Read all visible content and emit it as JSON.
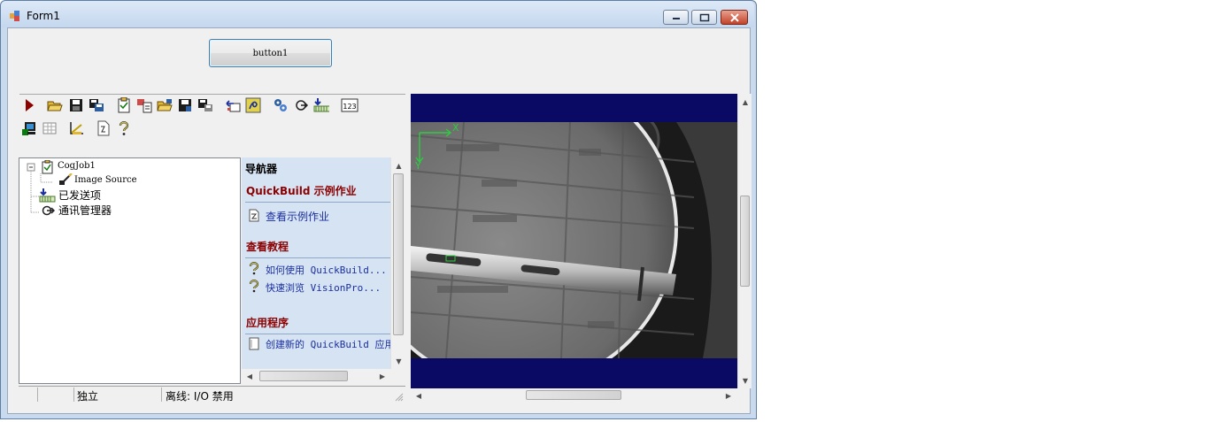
{
  "window": {
    "title": "Form1"
  },
  "form": {
    "button1_label": "button1"
  },
  "toolbar": {
    "row1": [
      "run-icon",
      "open-folder-icon",
      "save-icon",
      "save-all-icon",
      "job-properties-icon",
      "import-icon",
      "open-job-icon",
      "save-job-icon",
      "save-job-as-icon",
      "reset-icon",
      "help-topic-icon",
      "settings-icon",
      "refresh-icon",
      "posted-items-icon",
      "numeric-icon"
    ],
    "row2": [
      "display-icon",
      "grid-icon",
      "measure-icon",
      "document-icon",
      "question-icon"
    ]
  },
  "tree": {
    "job": "CogJob1",
    "image_source": "Image Source",
    "posted_items": "已发送项",
    "comm_manager": "通讯管理器"
  },
  "navigator": {
    "title": "导航器",
    "section1_title": "QuickBuild 示例作业",
    "section1_links": [
      "查看示例作业"
    ],
    "section2_title": "查看教程",
    "section2_links": [
      "如何使用 QuickBuild...",
      "快速浏览 VisionPro..."
    ],
    "section3_title": "应用程序",
    "section3_links": [
      "创建新的 QuickBuild 应用"
    ]
  },
  "status": {
    "mode": "独立",
    "connection": "离线: I/O 禁用"
  },
  "display": {
    "x_axis_label": "X",
    "y_axis_label": "Y"
  },
  "colors": {
    "nav_background": "#d6e3f3",
    "display_background": "#0a0a64",
    "axis_green": "#2ecc40",
    "heading_red": "#8b0000",
    "link_blue": "#1a2fa0"
  }
}
